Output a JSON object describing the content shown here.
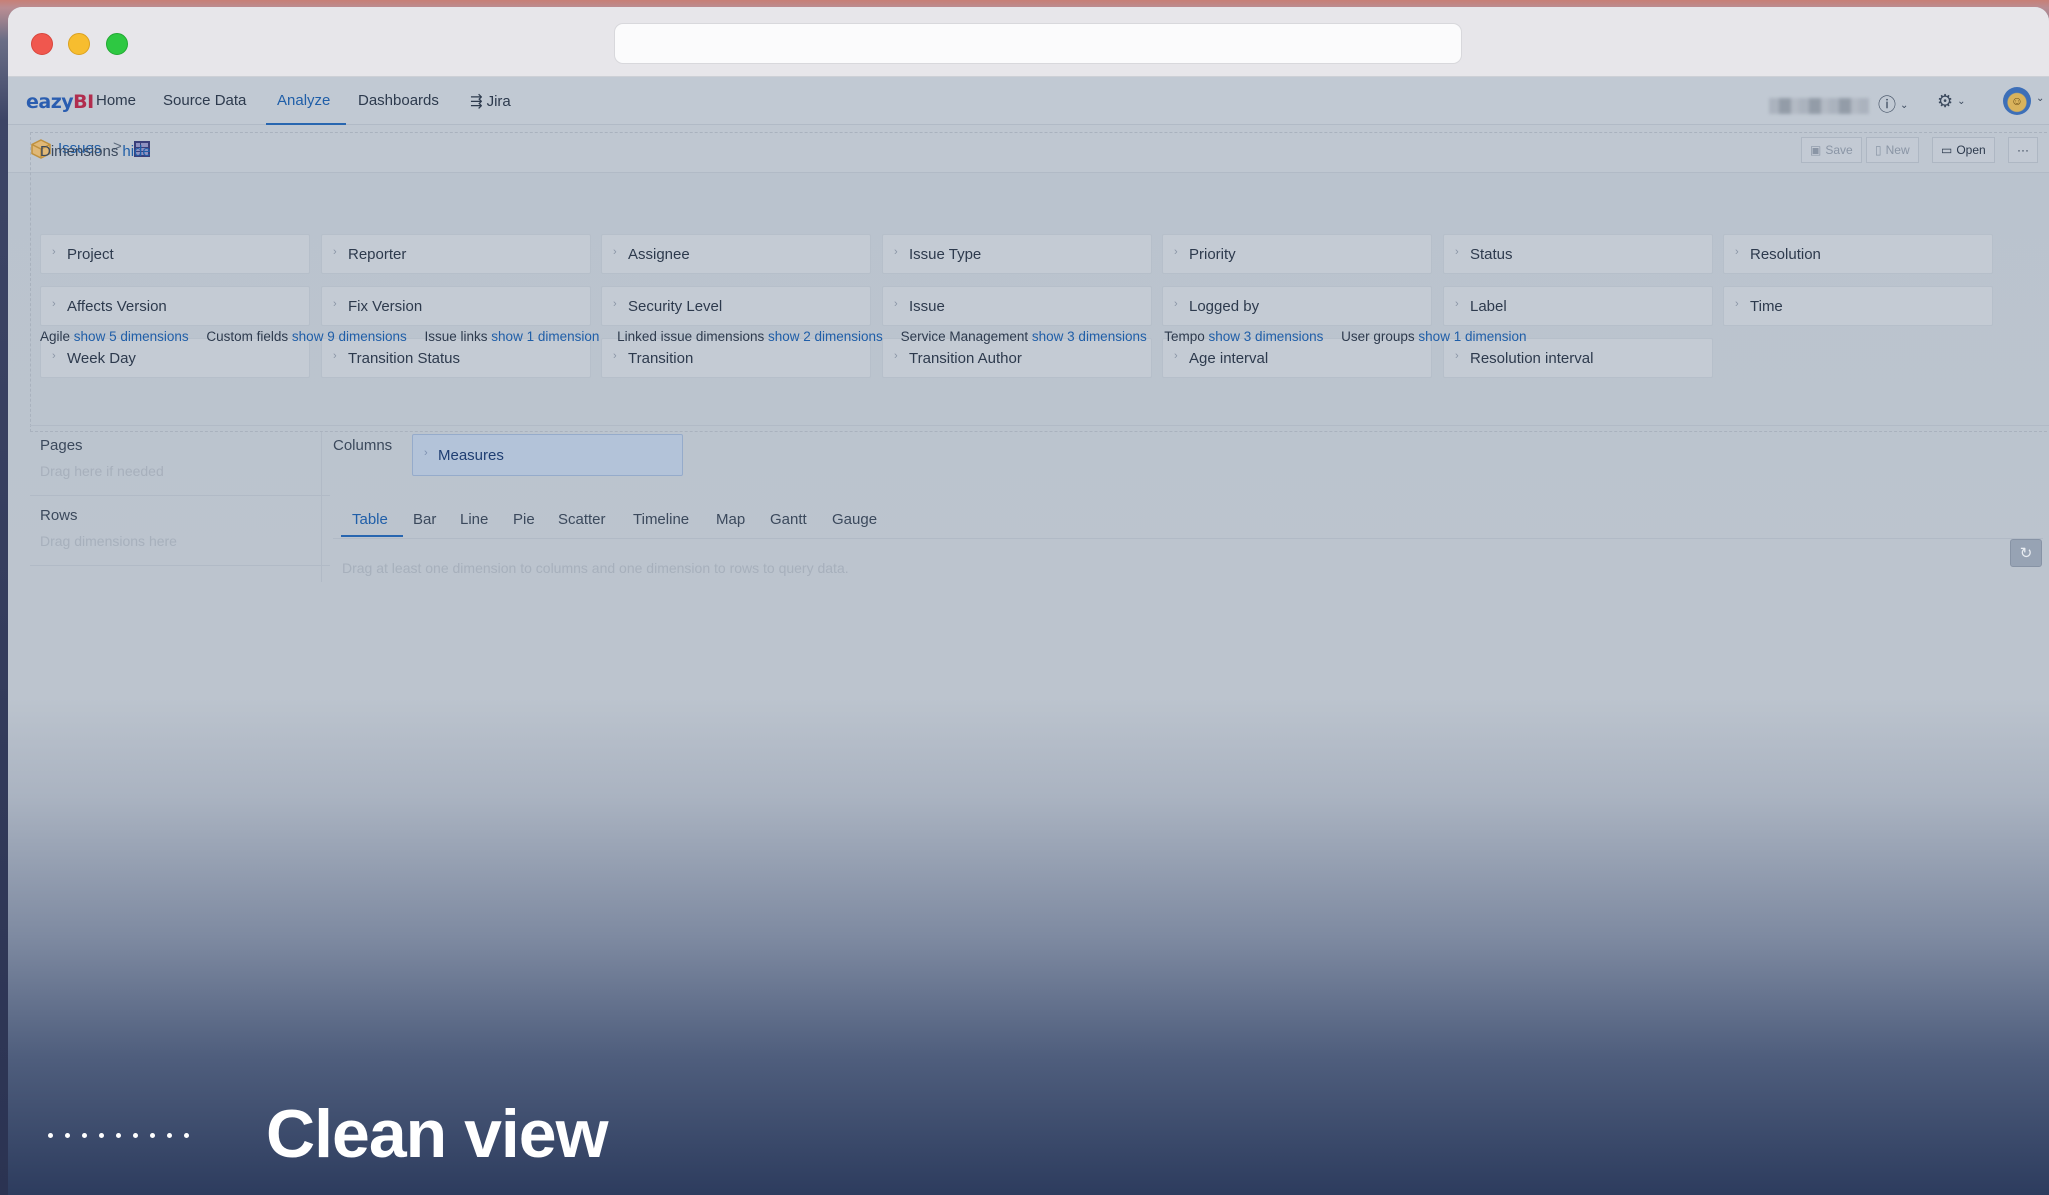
{
  "nav": {
    "logo_part1": "eazy",
    "logo_part2": "BI",
    "items": [
      {
        "label": "Home"
      },
      {
        "label": "Source Data"
      },
      {
        "label": "Analyze"
      },
      {
        "label": "Dashboards"
      },
      {
        "label": "Jira"
      }
    ],
    "active": "Analyze"
  },
  "breadcrumb": {
    "cube": "Issues",
    "separator": ">"
  },
  "toolbar": {
    "save_label": "Save",
    "new_label": "New",
    "open_label": "Open",
    "more_label": "···"
  },
  "dimensions": {
    "title": "Dimensions",
    "hide_label": "hide",
    "chips": [
      "Project",
      "Reporter",
      "Assignee",
      "Issue Type",
      "Priority",
      "Status",
      "Resolution",
      "Affects Version",
      "Fix Version",
      "Security Level",
      "Issue",
      "Logged by",
      "Label",
      "Time",
      "Week Day",
      "Transition Status",
      "Transition",
      "Transition Author",
      "Age interval",
      "Resolution interval"
    ],
    "groups": [
      {
        "name": "Agile",
        "link": "show 5 dimensions"
      },
      {
        "name": "Custom fields",
        "link": "show 9 dimensions"
      },
      {
        "name": "Issue links",
        "link": "show 1 dimension"
      },
      {
        "name": "Linked issue dimensions",
        "link": "show 2 dimensions"
      },
      {
        "name": "Service Management",
        "link": "show 3 dimensions"
      },
      {
        "name": "Tempo",
        "link": "show 3 dimensions"
      },
      {
        "name": "User groups",
        "link": "show 1 dimension"
      }
    ]
  },
  "layout": {
    "pages_label": "Pages",
    "pages_hint": "Drag here if needed",
    "columns_label": "Columns",
    "measures_label": "Measures",
    "rows_label": "Rows",
    "rows_hint": "Drag dimensions here"
  },
  "view_tabs": [
    "Table",
    "Bar",
    "Line",
    "Pie",
    "Scatter",
    "Timeline",
    "Map",
    "Gantt",
    "Gauge"
  ],
  "active_tab": "Table",
  "empty_hint": "Drag at least one dimension to columns and one dimension to rows to query data.",
  "caption": "Clean view",
  "colors": {
    "accent": "#1f5ea8",
    "overlay": "#bcc4ce",
    "traffic_red": "#f0574e",
    "traffic_yellow": "#f7bd2f",
    "traffic_green": "#2ec842"
  }
}
